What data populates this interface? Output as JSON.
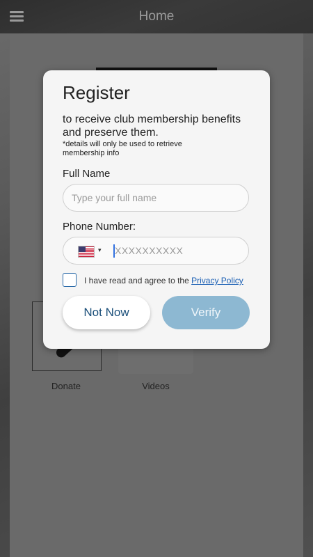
{
  "app": {
    "title": "Home",
    "tiles": [
      {
        "label": "Donate",
        "icon": "donate-icon"
      },
      {
        "label": "Videos",
        "icon": "videos-icon"
      }
    ]
  },
  "modal": {
    "title": "Register",
    "subtitle": "to receive club membership benefits and preserve them.",
    "note": "*details will only be used to retrieve membership info",
    "full_name": {
      "label": "Full Name",
      "placeholder": "Type your full name",
      "value": ""
    },
    "phone": {
      "label": "Phone Number:",
      "country_flag": "us-flag-icon",
      "caret": "▾",
      "placeholder": "XXXXXXXXXX",
      "value": ""
    },
    "agree": {
      "checked": false,
      "text": "I have read and agree to the ",
      "link": "Privacy Policy"
    },
    "buttons": {
      "not_now": "Not Now",
      "verify": "Verify"
    },
    "colors": {
      "link": "#1a5fb4",
      "verify_bg": "#8db8d2",
      "not_now_text": "#1b4f7a"
    }
  }
}
